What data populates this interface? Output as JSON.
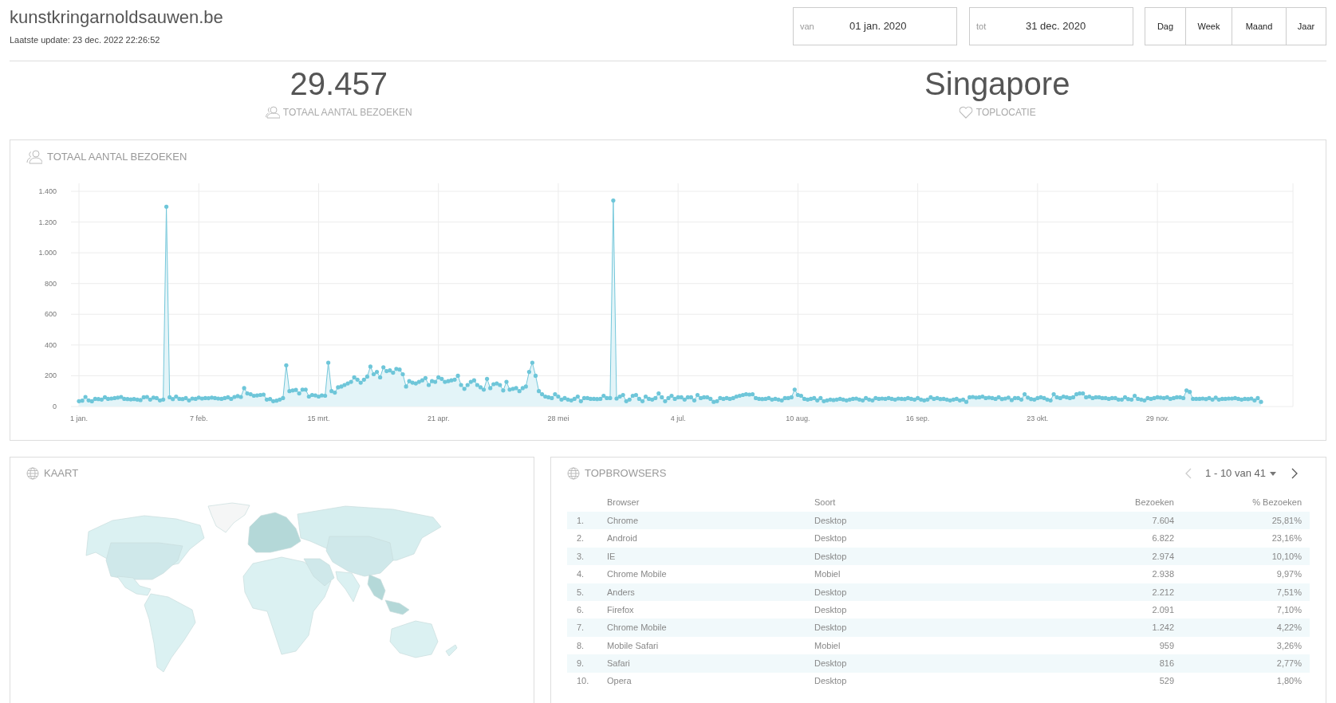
{
  "site": {
    "title": "kunstkringarnoldsauwen.be",
    "last_update": "Laatste update: 23 dec. 2022 22:26:52"
  },
  "date_range": [
    {
      "label": "van",
      "value": "01 jan. 2020"
    },
    {
      "label": "tot",
      "value": "31 dec. 2020"
    }
  ],
  "periods": [
    {
      "label": "Dag",
      "selected": false
    },
    {
      "label": "Week",
      "selected": false
    },
    {
      "label": "Maand",
      "selected": false
    },
    {
      "label": "Jaar",
      "selected": false
    }
  ],
  "stats": [
    {
      "kind": "visits",
      "value": "29.457",
      "label": "TOTAAL AANTAL BEZOEKEN"
    },
    {
      "kind": "location",
      "value": "Singapore",
      "label": "TOPLOCATIE"
    }
  ],
  "visits_card": {
    "title": "TOTAAL AANTAL BEZOEKEN",
    "chart_data": {
      "type": "area",
      "grid": true,
      "categories": [
        "1 jan.",
        null,
        null,
        null,
        null,
        null,
        null,
        null,
        null,
        null,
        null,
        null,
        null,
        null,
        null,
        null,
        null,
        null,
        null,
        null,
        null,
        null,
        null,
        null,
        null,
        null,
        null,
        null,
        null,
        null,
        null,
        null,
        null,
        null,
        null,
        null,
        null,
        "7 feb.",
        null,
        null,
        null,
        null,
        null,
        null,
        null,
        null,
        null,
        null,
        null,
        null,
        null,
        null,
        null,
        null,
        null,
        null,
        null,
        null,
        null,
        null,
        null,
        null,
        null,
        null,
        null,
        null,
        null,
        null,
        null,
        null,
        null,
        null,
        null,
        null,
        "15 mrt.",
        null,
        null,
        null,
        null,
        null,
        null,
        null,
        null,
        null,
        null,
        null,
        null,
        null,
        null,
        null,
        null,
        null,
        null,
        null,
        null,
        null,
        null,
        null,
        null,
        null,
        null,
        null,
        null,
        null,
        null,
        null,
        null,
        null,
        null,
        null,
        null,
        "21 apr.",
        null,
        null,
        null,
        null,
        null,
        null,
        null,
        null,
        null,
        null,
        null,
        null,
        null,
        null,
        null,
        null,
        null,
        null,
        null,
        null,
        null,
        null,
        null,
        null,
        null,
        null,
        null,
        null,
        null,
        null,
        null,
        null,
        null,
        null,
        null,
        null,
        "28 mei",
        null,
        null,
        null,
        null,
        null,
        null,
        null,
        null,
        null,
        null,
        null,
        null,
        null,
        null,
        null,
        null,
        null,
        null,
        null,
        null,
        null,
        null,
        null,
        null,
        null,
        null,
        null,
        null,
        null,
        null,
        null,
        null,
        null,
        null,
        null,
        null,
        "4 jul.",
        null,
        null,
        null,
        null,
        null,
        null,
        null,
        null,
        null,
        null,
        null,
        null,
        null,
        null,
        null,
        null,
        null,
        null,
        null,
        null,
        null,
        null,
        null,
        null,
        null,
        null,
        null,
        null,
        null,
        null,
        null,
        null,
        null,
        null,
        null,
        null,
        "10 aug.",
        null,
        null,
        null,
        null,
        null,
        null,
        null,
        null,
        null,
        null,
        null,
        null,
        null,
        null,
        null,
        null,
        null,
        null,
        null,
        null,
        null,
        null,
        null,
        null,
        null,
        null,
        null,
        null,
        null,
        null,
        null,
        null,
        null,
        null,
        null,
        null,
        "16 sep.",
        null,
        null,
        null,
        null,
        null,
        null,
        null,
        null,
        null,
        null,
        null,
        null,
        null,
        null,
        null,
        null,
        null,
        null,
        null,
        null,
        null,
        null,
        null,
        null,
        null,
        null,
        null,
        null,
        null,
        null,
        null,
        null,
        null,
        null,
        null,
        null,
        "23 okt.",
        null,
        null,
        null,
        null,
        null,
        null,
        null,
        null,
        null,
        null,
        null,
        null,
        null,
        null,
        null,
        null,
        null,
        null,
        null,
        null,
        null,
        null,
        null,
        null,
        null,
        null,
        null,
        null,
        null,
        null,
        null,
        null,
        null,
        null,
        null,
        null,
        "29 nov.",
        null,
        null,
        null,
        null,
        null,
        null,
        null,
        null,
        null,
        null,
        null,
        null,
        null,
        null,
        null,
        null,
        null,
        null,
        null,
        null,
        null,
        null,
        null,
        null,
        null,
        null,
        null,
        null,
        null,
        null,
        null,
        null
      ],
      "values": [
        35,
        38,
        62,
        40,
        34,
        50,
        48,
        45,
        60,
        50,
        52,
        55,
        58,
        62,
        50,
        48,
        46,
        48,
        45,
        42,
        60,
        62,
        45,
        58,
        55,
        40,
        45,
        1300,
        60,
        48,
        65,
        50,
        48,
        55,
        40,
        52,
        50,
        58,
        52,
        55,
        54,
        58,
        55,
        52,
        50,
        55,
        60,
        50,
        62,
        68,
        62,
        120,
        85,
        80,
        70,
        72,
        75,
        78,
        45,
        48,
        35,
        38,
        45,
        55,
        268,
        100,
        105,
        108,
        85,
        110,
        110,
        65,
        75,
        72,
        65,
        72,
        70,
        285,
        100,
        90,
        125,
        130,
        140,
        150,
        160,
        190,
        175,
        155,
        175,
        195,
        260,
        210,
        225,
        190,
        255,
        230,
        235,
        220,
        245,
        240,
        210,
        130,
        165,
        155,
        150,
        160,
        170,
        185,
        140,
        165,
        160,
        190,
        180,
        160,
        165,
        170,
        175,
        200,
        140,
        115,
        140,
        160,
        170,
        140,
        125,
        110,
        180,
        120,
        145,
        150,
        140,
        105,
        160,
        110,
        115,
        120,
        100,
        120,
        130,
        225,
        285,
        200,
        100,
        80,
        65,
        60,
        55,
        80,
        65,
        45,
        55,
        45,
        40,
        50,
        65,
        35,
        55,
        55,
        50,
        50,
        48,
        50,
        70,
        55,
        55,
        1340,
        52,
        65,
        75,
        35,
        45,
        70,
        75,
        50,
        35,
        65,
        50,
        45,
        55,
        85,
        60,
        35,
        55,
        70,
        50,
        60,
        60,
        45,
        60,
        60,
        40,
        75,
        55,
        60,
        60,
        50,
        30,
        35,
        55,
        50,
        55,
        50,
        55,
        65,
        70,
        75,
        80,
        78,
        80,
        55,
        50,
        48,
        50,
        55,
        45,
        50,
        45,
        40,
        55,
        55,
        60,
        110,
        75,
        70,
        50,
        45,
        50,
        55,
        40,
        55,
        35,
        40,
        45,
        42,
        45,
        50,
        45,
        40,
        45,
        50,
        52,
        45,
        40,
        55,
        45,
        40,
        55,
        50,
        52,
        50,
        55,
        50,
        45,
        52,
        50,
        48,
        55,
        50,
        45,
        55,
        45,
        40,
        45,
        60,
        50,
        55,
        48,
        50,
        45,
        40,
        45,
        50,
        40,
        45,
        30,
        60,
        62,
        58,
        60,
        65,
        55,
        58,
        55,
        50,
        60,
        48,
        52,
        58,
        42,
        55,
        55,
        45,
        80,
        58,
        48,
        45,
        55,
        60,
        55,
        45,
        40,
        80,
        60,
        55,
        65,
        60,
        55,
        60,
        80,
        85,
        85,
        60,
        65,
        55,
        60,
        60,
        55,
        55,
        50,
        55,
        55,
        45,
        45,
        60,
        48,
        45,
        70,
        50,
        45,
        40,
        55,
        50,
        55,
        60,
        58,
        55,
        60,
        50,
        55,
        60,
        60,
        55,
        105,
        95,
        50,
        50,
        50,
        52,
        48,
        55,
        45,
        58,
        45,
        50,
        50,
        52,
        52,
        55,
        50,
        45,
        50,
        48,
        52,
        40,
        55,
        30
      ],
      "ylim": [
        0,
        1400
      ],
      "yticks": [
        {
          "value": 0,
          "label": "0"
        },
        {
          "value": 200,
          "label": "200"
        },
        {
          "value": 400,
          "label": "400"
        },
        {
          "value": 600,
          "label": "600"
        },
        {
          "value": 800,
          "label": "800"
        },
        {
          "value": 1000,
          "label": "1.000"
        },
        {
          "value": 1200,
          "label": "1.200"
        },
        {
          "value": 1400,
          "label": "1.400"
        }
      ]
    }
  },
  "map_card": {
    "title": "KAART"
  },
  "browsers_card": {
    "title": "TOPBROWSERS",
    "pagination": {
      "label": "1 - 10 van 41",
      "prev_disabled": true
    },
    "columns": [
      "Browser",
      "Soort",
      "Bezoeken",
      "% Bezoeken"
    ],
    "rows": [
      {
        "rank": "1.",
        "browser": "Chrome",
        "type": "Desktop",
        "visits": "7.604",
        "share": "25,81%"
      },
      {
        "rank": "2.",
        "browser": "Android",
        "type": "Desktop",
        "visits": "6.822",
        "share": "23,16%"
      },
      {
        "rank": "3.",
        "browser": "IE",
        "type": "Desktop",
        "visits": "2.974",
        "share": "10,10%"
      },
      {
        "rank": "4.",
        "browser": "Chrome Mobile",
        "type": "Mobiel",
        "visits": "2.938",
        "share": "9,97%"
      },
      {
        "rank": "5.",
        "browser": "Anders",
        "type": "Desktop",
        "visits": "2.212",
        "share": "7,51%"
      },
      {
        "rank": "6.",
        "browser": "Firefox",
        "type": "Desktop",
        "visits": "2.091",
        "share": "7,10%"
      },
      {
        "rank": "7.",
        "browser": "Chrome Mobile",
        "type": "Desktop",
        "visits": "1.242",
        "share": "4,22%"
      },
      {
        "rank": "8.",
        "browser": "Mobile Safari",
        "type": "Mobiel",
        "visits": "959",
        "share": "3,26%"
      },
      {
        "rank": "9.",
        "browser": "Safari",
        "type": "Desktop",
        "visits": "816",
        "share": "2,77%"
      },
      {
        "rank": "10.",
        "browser": "Opera",
        "type": "Desktop",
        "visits": "529",
        "share": "1,80%"
      }
    ]
  }
}
